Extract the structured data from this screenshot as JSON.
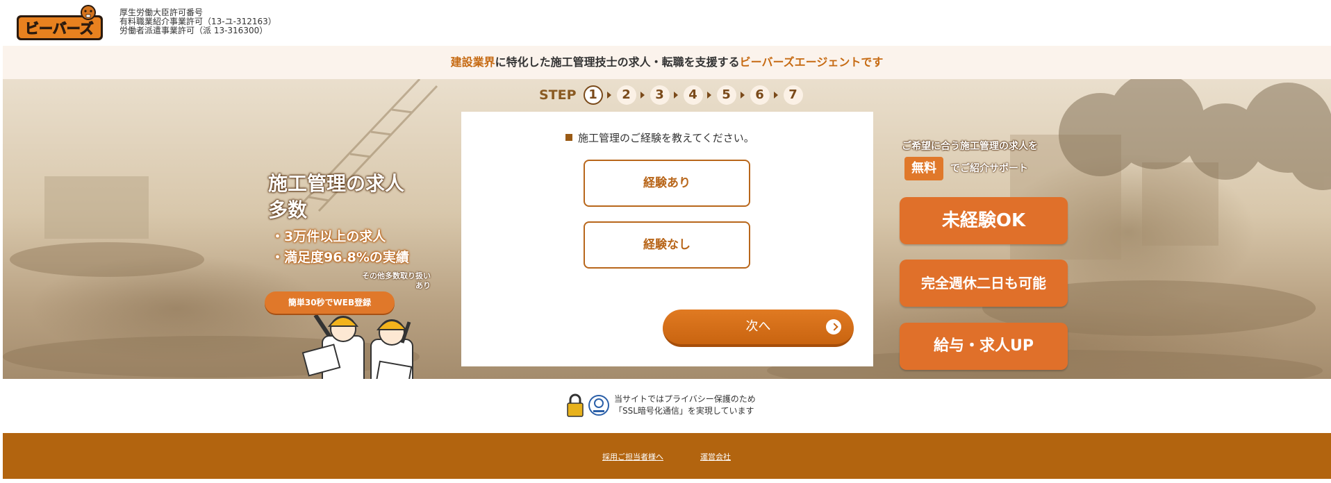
{
  "header": {
    "logo_text": "ビーバーズ",
    "license_lines": [
      "厚生労働大臣許可番号",
      "有料職業紹介事業許可（13-ユ-312163）",
      "労働者派遣事業許可（派 13-316300）"
    ]
  },
  "banner": {
    "part1": "建設業界",
    "part2": "に特化した施工管理技士の求人・転職を支援する",
    "part3": "ビーバーズエージェントです"
  },
  "steps": {
    "label": "STEP",
    "items": [
      "1",
      "2",
      "3",
      "4",
      "5",
      "6",
      "7"
    ],
    "active": 1
  },
  "form": {
    "question": "施工管理のご経験を教えてください。",
    "option1": "経験あり",
    "option2": "経験なし",
    "next": "次へ"
  },
  "left_promo": {
    "title_line1": "施工管理の求人",
    "title_line2": "多数",
    "bullet1": "・3万件以上の求人",
    "bullet2": "・満足度96.8%の実績",
    "note1": "その他多数取り扱い",
    "note2": "あり",
    "button": "簡単30秒でWEB登録"
  },
  "right_promo": {
    "head": "ご希望に合う施工管理の求人を",
    "badge": "無料",
    "sub": "でご紹介サポート",
    "features": [
      "未経験OK",
      "完全週休二日も可能",
      "給与・求人UP"
    ]
  },
  "ssl": {
    "line1": "当サイトではプライバシー保護のため",
    "line2": "「SSL暗号化通信」を実現しています"
  },
  "footer": {
    "link1": "採用ご担当者様へ",
    "link2": "運営会社"
  },
  "colors": {
    "brand": "#e0702a",
    "brand_dark": "#b2640f",
    "strip_bg": "#fbf3ec"
  }
}
